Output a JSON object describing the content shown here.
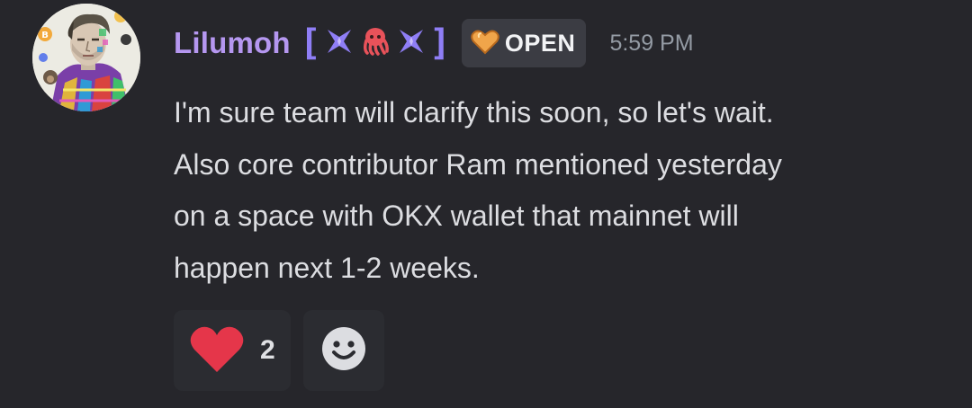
{
  "message": {
    "author": {
      "username": "Lilumoh",
      "avatar_icon": "avatar-portrait-icon",
      "name_color": "#b597f0",
      "clan_tag": {
        "bracket_open": "[",
        "bracket_close": "]",
        "icons": [
          "cross-star-icon",
          "octopus-icon",
          "cross-star-icon"
        ],
        "color": "#8f7ef6"
      },
      "status_badge": {
        "icon": "orange-heart-icon",
        "text": "OPEN"
      }
    },
    "timestamp": "5:59 PM",
    "lines": [
      "I'm sure team will clarify this soon, so let's wait.",
      "Also core contributor Ram mentioned yesterday",
      "on a space with OKX wallet that mainnet will",
      "happen next 1-2 weeks."
    ]
  },
  "reactions": [
    {
      "emoji": "red-heart-icon",
      "count": "2"
    }
  ],
  "add_reaction": {
    "icon": "smiley-add-reaction-icon"
  },
  "colors": {
    "background": "#26262b",
    "text": "#dcdde1",
    "timestamp": "#949ba4",
    "reaction_bg": "#2b2c31",
    "heart": "#e5364a"
  }
}
